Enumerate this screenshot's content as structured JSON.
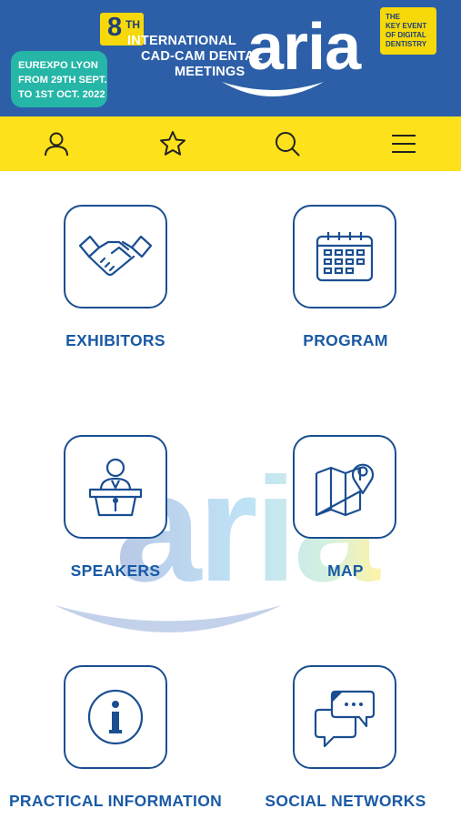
{
  "banner": {
    "edition_number": "8",
    "edition_suffix": "TH",
    "event_lines": [
      "INTERNATIONAL",
      "CAD-CAM DENTAL",
      "MEETINGS"
    ],
    "venue_lines": [
      "EUREXPO LYON",
      "FROM 29TH SEPT.",
      "TO 1ST OCT. 2022"
    ],
    "logo_text": "aria",
    "key_event_lines": [
      "THE",
      "KEY EVENT",
      "OF DIGITAL",
      "DENTISTRY"
    ]
  },
  "toolbar": {
    "items": [
      {
        "name": "profile",
        "icon": "user-icon"
      },
      {
        "name": "favorites",
        "icon": "star-icon"
      },
      {
        "name": "search",
        "icon": "search-icon"
      },
      {
        "name": "menu",
        "icon": "hamburger-menu-icon"
      }
    ]
  },
  "menu": {
    "items": [
      {
        "label": "EXHIBITORS",
        "icon": "handshake-icon"
      },
      {
        "label": "PROGRAM",
        "icon": "calendar-icon"
      },
      {
        "label": "SPEAKERS",
        "icon": "speaker-podium-icon"
      },
      {
        "label": "MAP",
        "icon": "map-pin-icon"
      },
      {
        "label": "PRACTICAL INFORMATION",
        "icon": "info-icon"
      },
      {
        "label": "SOCIAL NETWORKS",
        "icon": "chat-bubbles-icon"
      }
    ]
  },
  "watermark": {
    "text": "aria"
  },
  "colors": {
    "banner_bg": "#2c5fa8",
    "toolbar_bg": "#fde11a",
    "accent_yellow": "#f5d90a",
    "venue_teal": "#25b6a7",
    "tile_border": "#1a4e91",
    "label_blue": "#1a5aa5"
  }
}
